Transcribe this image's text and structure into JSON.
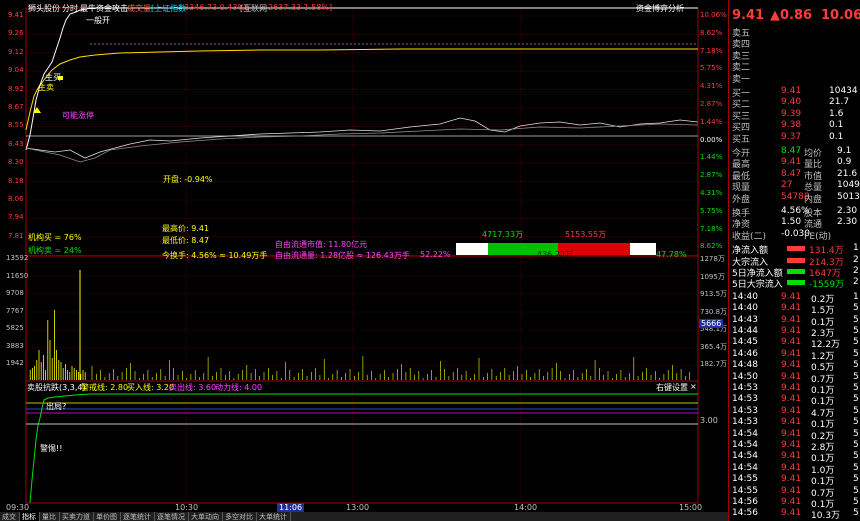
{
  "header": {
    "stock": "狮头股份",
    "mode": "分时",
    "indicator": "最牛资金攻击",
    "volume_label": "成交量",
    "index_label": "[上证指数",
    "index_value": "3346.73 0.43%]",
    "other_label": "[互联网",
    "other_value": "2637.33 1.58%]",
    "right_action": "资金博弈分析"
  },
  "price_axis_left": [
    "9.41",
    "9.26",
    "9.12",
    "9.04",
    "8.92",
    "8.67",
    "8.55",
    "8.43",
    "8.30",
    "8.18",
    "8.06",
    "7.94",
    "7.81"
  ],
  "price_axis_right": [
    "10.06%",
    "8.62%",
    "7.18%",
    "5.75%",
    "4.31%",
    "2.87%",
    "1.44%",
    "0.00%",
    "1.44%",
    "2.87%",
    "4.31%",
    "5.75%",
    "7.18%",
    "8.62%"
  ],
  "volume_axis_left": [
    "13592",
    "11650",
    "9708",
    "7767",
    "5825",
    "3883",
    "1942"
  ],
  "volume_axis_right": [
    "1278万",
    "1095万",
    "913.5万",
    "730.8万",
    "548.1万",
    "365.4万",
    "182.7万"
  ],
  "volume_marker": "5666",
  "chart_labels": {
    "limit_up": "一般开",
    "main_buy": "主买",
    "main_sell": "主卖",
    "can_buy": "可能涨停",
    "open_text": "开盘: -0.94%",
    "inst_buy": "机构买 = 76%",
    "inst_sell": "机构卖 = 24%",
    "max_text": "最高价: 9.41",
    "min_text": "最低价: 8.47",
    "turnover_text": "今换手: 4.56% ≈ 10.49万手",
    "float_cap": "自由流通市值: 11.80亿元",
    "float_shares": "自由流通量: 1.28亿股 ≈ 126.43万手",
    "pct_a": "52.22%",
    "buy_amount": "4717.33万",
    "sell_amount": "5153.55万",
    "mid_amount": "436.22万",
    "pct_b": "47.78%"
  },
  "indicator_bar": {
    "name": "卖股抗跌(3,3,4)",
    "alert_line": "警戒线: 2.80",
    "buy_line": "买入线: 3.20",
    "sell_line": "卖出线: 3.60",
    "power_line": "动力线: 4.00",
    "right_action": "右键设置",
    "close": "×",
    "axis_value": "3.00",
    "where": "出局?",
    "warning": "警惕!!"
  },
  "time_axis": [
    "09:30",
    "10:30",
    "11:06",
    "13:00",
    "14:00",
    "15:00"
  ],
  "bottom_tabs": [
    "成交",
    "指标",
    "量比",
    "买卖力道",
    "单价图",
    "逐笔统计",
    "逐笔情况",
    "大单动向",
    "多空对比",
    "大单统计"
  ],
  "quote": {
    "price": "9.41",
    "arrow_change": "▲0.86",
    "change_pct": "10.06%",
    "sells": [
      {
        "label": "卖五",
        "price": "",
        "vol": ""
      },
      {
        "label": "卖四",
        "price": "",
        "vol": ""
      },
      {
        "label": "卖三",
        "price": "",
        "vol": ""
      },
      {
        "label": "卖二",
        "price": "",
        "vol": ""
      },
      {
        "label": "卖一",
        "price": "",
        "vol": ""
      }
    ],
    "buys": [
      {
        "label": "买一",
        "price": "9.41",
        "vol": "10434"
      },
      {
        "label": "买二",
        "price": "9.40",
        "vol": "21.7"
      },
      {
        "label": "买三",
        "price": "9.39",
        "vol": "1.6"
      },
      {
        "label": "买四",
        "price": "9.38",
        "vol": "0.1"
      },
      {
        "label": "买五",
        "price": "9.37",
        "vol": "0.1"
      }
    ],
    "stats": [
      {
        "l1": "今开",
        "v1": "8.47",
        "l2": "均价",
        "v2": "9.1"
      },
      {
        "l1": "最高",
        "v1": "9.41",
        "l2": "量比",
        "v2": "0.9"
      },
      {
        "l1": "最低",
        "v1": "8.47",
        "l2": "市值",
        "v2": "21.6"
      },
      {
        "l1": "现量",
        "v1": "27",
        "l2": "总量",
        "v2": "10491"
      },
      {
        "l1": "外盘",
        "v1": "54788",
        "l2": "内盘",
        "v2": "5013"
      }
    ],
    "stats2": [
      {
        "l1": "换手",
        "v1": "4.56%",
        "l2": "股本",
        "v2": "2.30"
      },
      {
        "l1": "净资",
        "v1": "1.50",
        "l2": "流通",
        "v2": "2.30"
      },
      {
        "l1": "收益(二)",
        "v1": "-0.030",
        "l2": "PE(动)",
        "v2": ""
      }
    ],
    "flows": [
      {
        "label": "净流入额",
        "value": "131.4万",
        "tail": "1"
      },
      {
        "label": "大宗流入",
        "value": "214.3万",
        "tail": "2"
      },
      {
        "label": "5日净流入额",
        "value": "1647万",
        "tail": "2"
      },
      {
        "label": "5日大宗流入",
        "value": "-1559万",
        "tail": "2"
      }
    ],
    "ticks": [
      {
        "t": "14:40",
        "p": "9.41",
        "v": "0.2万",
        "n": "1"
      },
      {
        "t": "14:40",
        "p": "9.41",
        "v": "1.5万",
        "n": "5"
      },
      {
        "t": "14:43",
        "p": "9.41",
        "v": "0.1万",
        "n": "5"
      },
      {
        "t": "14:44",
        "p": "9.41",
        "v": "2.3万",
        "n": "5"
      },
      {
        "t": "14:45",
        "p": "9.41",
        "v": "12.2万",
        "n": "5"
      },
      {
        "t": "14:46",
        "p": "9.41",
        "v": "1.2万",
        "n": "5"
      },
      {
        "t": "14:48",
        "p": "9.41",
        "v": "0.5万",
        "n": "5"
      },
      {
        "t": "14:50",
        "p": "9.41",
        "v": "0.7万",
        "n": "5"
      },
      {
        "t": "14:53",
        "p": "9.41",
        "v": "0.1万",
        "n": "5"
      },
      {
        "t": "14:53",
        "p": "9.41",
        "v": "0.1万",
        "n": "5"
      },
      {
        "t": "14:53",
        "p": "9.41",
        "v": "4.7万",
        "n": "5"
      },
      {
        "t": "14:53",
        "p": "9.41",
        "v": "0.1万",
        "n": "5"
      },
      {
        "t": "14:54",
        "p": "9.41",
        "v": "0.2万",
        "n": "5"
      },
      {
        "t": "14:54",
        "p": "9.41",
        "v": "2.8万",
        "n": "5"
      },
      {
        "t": "14:54",
        "p": "9.41",
        "v": "0.1万",
        "n": "5"
      },
      {
        "t": "14:54",
        "p": "9.41",
        "v": "1.0万",
        "n": "5"
      },
      {
        "t": "14:55",
        "p": "9.41",
        "v": "0.1万",
        "n": "5"
      },
      {
        "t": "14:55",
        "p": "9.41",
        "v": "0.7万",
        "n": "5"
      },
      {
        "t": "14:56",
        "p": "9.41",
        "v": "0.1万",
        "n": "5"
      },
      {
        "t": "14:56",
        "p": "9.41",
        "v": "10.3万",
        "n": "5"
      },
      {
        "t": "14:56",
        "p": "9.41",
        "v": "0.1万",
        "n": "5"
      },
      {
        "t": "15:00",
        "p": "9.41",
        "v": "2.5万",
        "n": "5"
      }
    ]
  }
}
